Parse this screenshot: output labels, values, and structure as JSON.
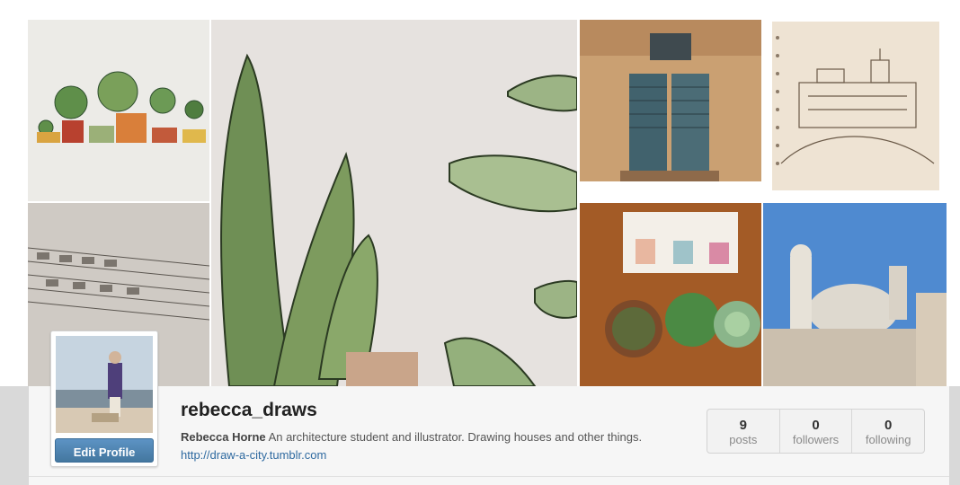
{
  "profile": {
    "username": "rebecca_draws",
    "full_name": "Rebecca Horne",
    "bio": "An architecture student and illustrator. Drawing houses and other things.",
    "website": "http://draw-a-city.tumblr.com",
    "edit_label": "Edit Profile"
  },
  "stats": [
    {
      "value": "9",
      "label": "posts"
    },
    {
      "value": "0",
      "label": "followers"
    },
    {
      "value": "0",
      "label": "following"
    }
  ]
}
